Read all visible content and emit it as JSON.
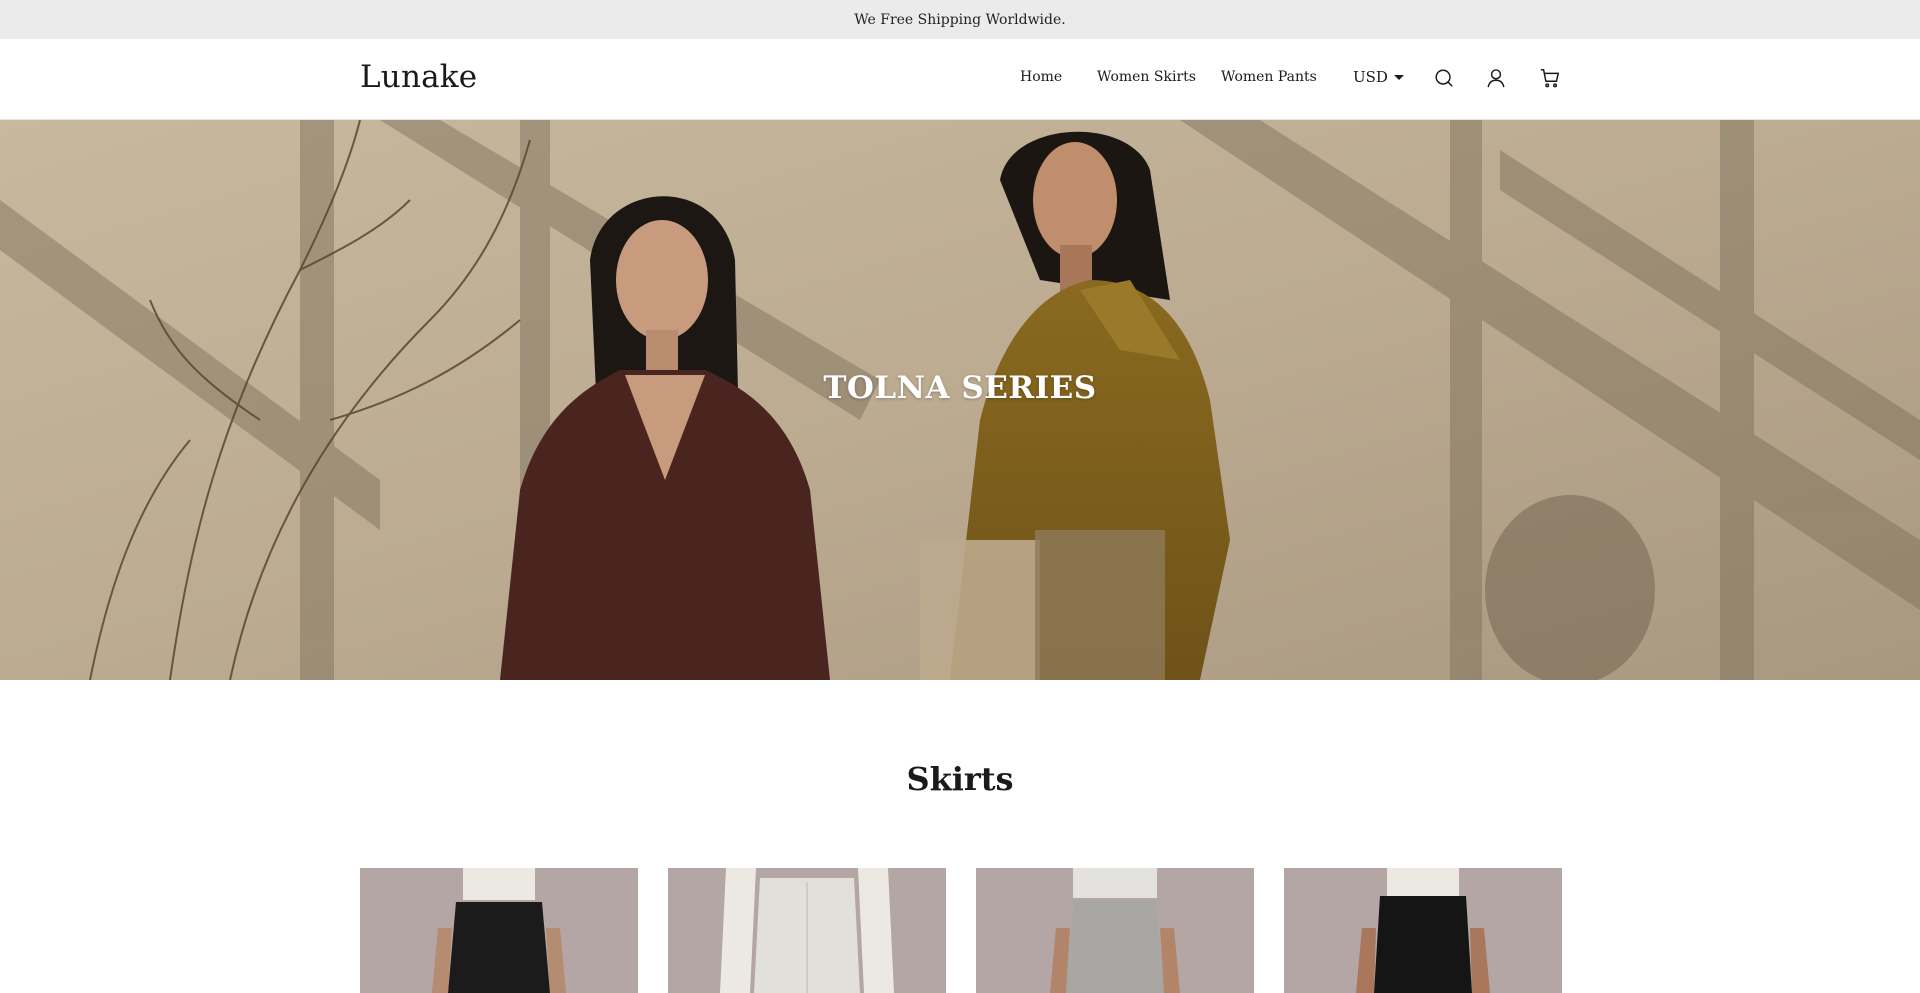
{
  "announcement": {
    "text": "We Free Shipping Worldwide."
  },
  "header": {
    "logo": "Lunake",
    "nav": [
      {
        "label": "Home"
      },
      {
        "label": "Women Skirts"
      },
      {
        "label": "Women Pants"
      }
    ],
    "currency": {
      "selected": "USD"
    },
    "icons": [
      "search-icon",
      "account-icon",
      "cart-icon"
    ]
  },
  "hero": {
    "title": "TOLNA SERIES"
  },
  "collection": {
    "title": "Skirts",
    "products": [
      {
        "image": "black textured pencil skirt"
      },
      {
        "image": "white midi skirt"
      },
      {
        "image": "grey pencil skirt"
      },
      {
        "image": "black pencil skirt"
      }
    ]
  },
  "colors": {
    "announcement_bg": "#ebebeb",
    "hero_bg": "#b9a990",
    "product_bg": "#b3a6a5",
    "text": "#1a1a1a"
  }
}
